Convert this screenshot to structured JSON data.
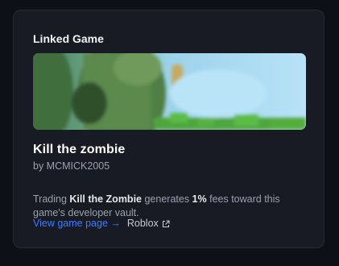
{
  "card": {
    "heading": "Linked Game"
  },
  "game": {
    "title": "Kill the zombie",
    "byline": "by MCMICK2005",
    "description": {
      "prefix": "Trading ",
      "name": "Kill the Zombie",
      "middle": " generates ",
      "percent": "1%",
      "suffix": " fees toward this game's developer vault."
    }
  },
  "links": {
    "view_game": "View game page →",
    "platform": "Roblox",
    "platform_icon": "external-link-icon"
  },
  "colors": {
    "background": "#0e1018",
    "card": "#181b23",
    "link": "#3d7bff",
    "muted_text": "#9aa1ad"
  }
}
